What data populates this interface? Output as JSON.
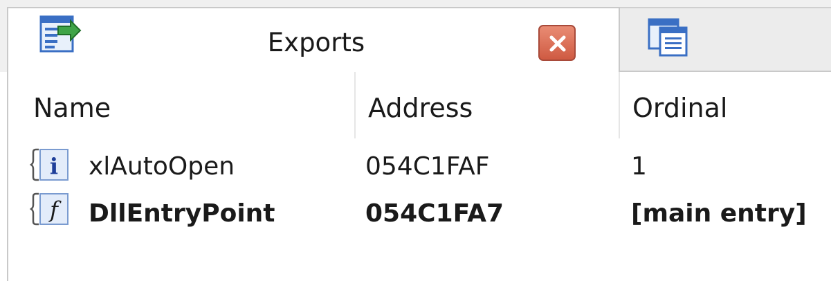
{
  "tabs": [
    {
      "label": "Exports",
      "icon": "exports-icon",
      "active": true
    },
    {
      "label": "",
      "icon": "document-list-icon",
      "active": false
    }
  ],
  "list": {
    "columns": [
      "Name",
      "Address",
      "Ordinal"
    ],
    "rows": [
      {
        "icon": "info-icon",
        "name": "xlAutoOpen",
        "address": "054C1FAF",
        "ordinal": "1",
        "bold": false
      },
      {
        "icon": "function-icon",
        "name": "DllEntryPoint",
        "address": "054C1FA7",
        "ordinal": "[main entry]",
        "bold": true
      }
    ]
  },
  "colors": {
    "close_button": "#d9654c",
    "icon_blue": "#3a6fc4",
    "tab_border": "#c9c9c9"
  }
}
